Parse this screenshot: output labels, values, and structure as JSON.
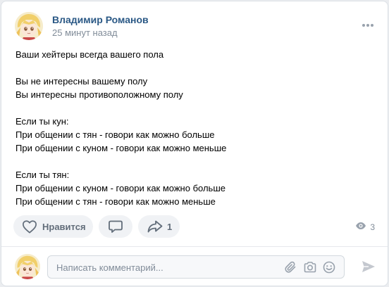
{
  "post": {
    "author": "Владимир Романов",
    "time": "25 минут назад",
    "text_lines": [
      "Ваши хейтеры всегда вашего пола",
      "",
      "Вы не интересны вашему полу",
      "Вы интересны противоположному полу",
      "",
      "Если ты кун:",
      "При общении с тян - говори как можно больше",
      "При общении с куном - говори как можно меньше",
      "",
      "Если ты тян:",
      "При общении с куном - говори как можно больше",
      "При общении с тян - говори как можно меньше"
    ]
  },
  "actions": {
    "like_label": "Нравится",
    "share_count": "1",
    "views_count": "3"
  },
  "comment": {
    "placeholder": "Написать комментарий..."
  },
  "icons": {
    "more": "more-horizontal-icon",
    "like": "heart-outline-icon",
    "comment": "comment-bubble-icon",
    "share": "share-arrow-icon",
    "views": "eye-icon",
    "attach": "paperclip-icon",
    "camera": "camera-icon",
    "emoji": "smile-icon",
    "send": "send-arrow-icon"
  },
  "colors": {
    "author_link": "#2a5885",
    "secondary_text": "#818c99",
    "button_bg": "#f0f2f5",
    "button_icon": "#626d7a",
    "page_bg": "#ebedf0"
  }
}
